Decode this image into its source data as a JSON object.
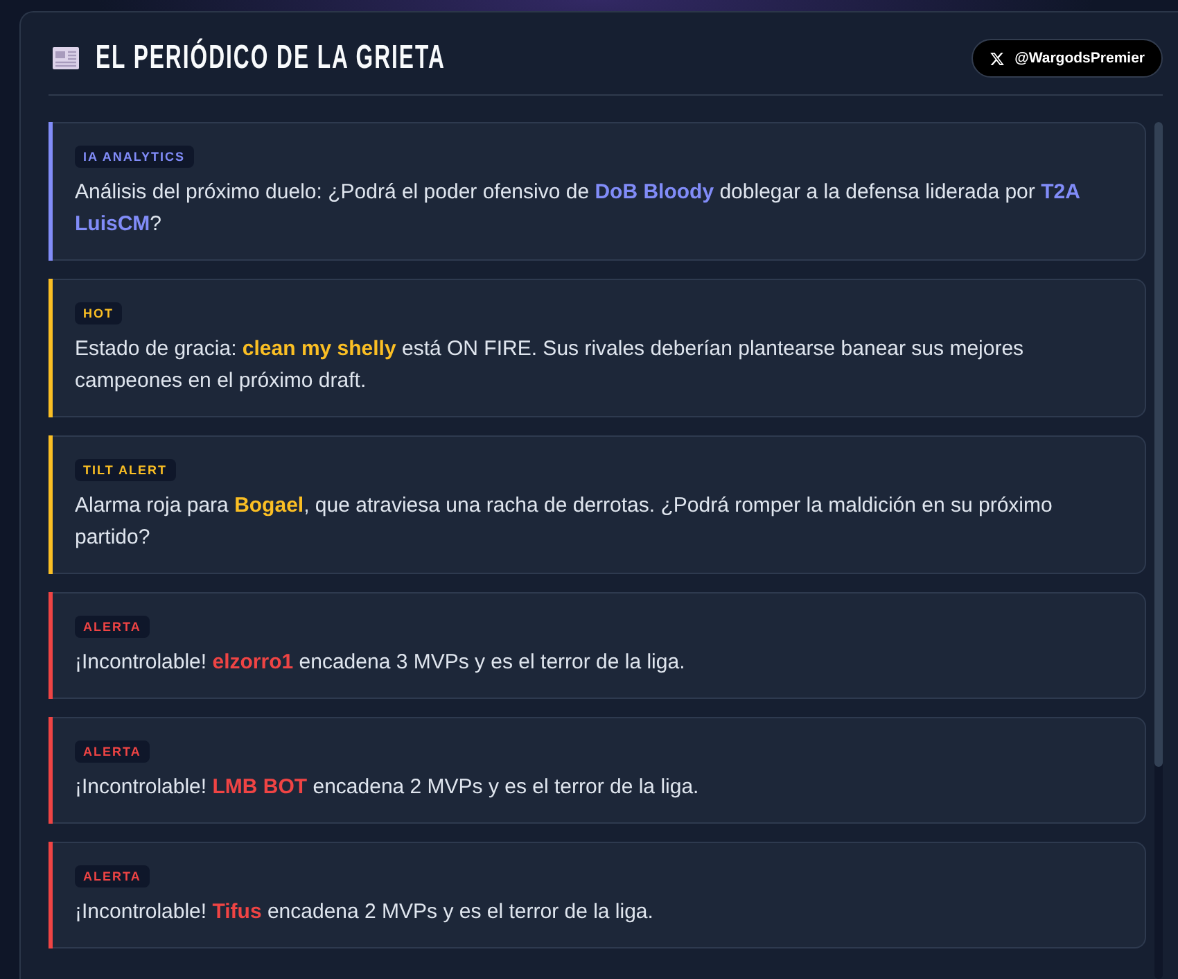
{
  "header": {
    "title": "EL PERIÓDICO DE LA GRIETA",
    "social_handle": "@WargodsPremier"
  },
  "news": [
    {
      "tag": "IA ANALYTICS",
      "color": "#818cf8",
      "text": "Análisis del próximo duelo: ¿Podrá el poder ofensivo de **DoB Bloody** doblegar a la defensa liderada por **T2A LuisCM**?"
    },
    {
      "tag": "HOT",
      "color": "#fbbf24",
      "text": "Estado de gracia: **clean my shelly** está ON FIRE. Sus rivales deberían plantearse banear sus mejores campeones en el próximo draft."
    },
    {
      "tag": "TILT ALERT",
      "color": "#fbbf24",
      "text": "Alarma roja para **Bogael**, que atraviesa una racha de derrotas. ¿Podrá romper la maldición en su próximo partido?"
    },
    {
      "tag": "ALERTA",
      "color": "#ef4444",
      "text": "¡Incontrolable! **elzorro1** encadena 3 MVPs y es el terror de la liga."
    },
    {
      "tag": "ALERTA",
      "color": "#ef4444",
      "text": "¡Incontrolable! **LMB BOT** encadena 2 MVPs y es el terror de la liga."
    },
    {
      "tag": "ALERTA",
      "color": "#ef4444",
      "text": "¡Incontrolable! **Tifus** encadena 2 MVPs y es el terror de la liga."
    }
  ]
}
